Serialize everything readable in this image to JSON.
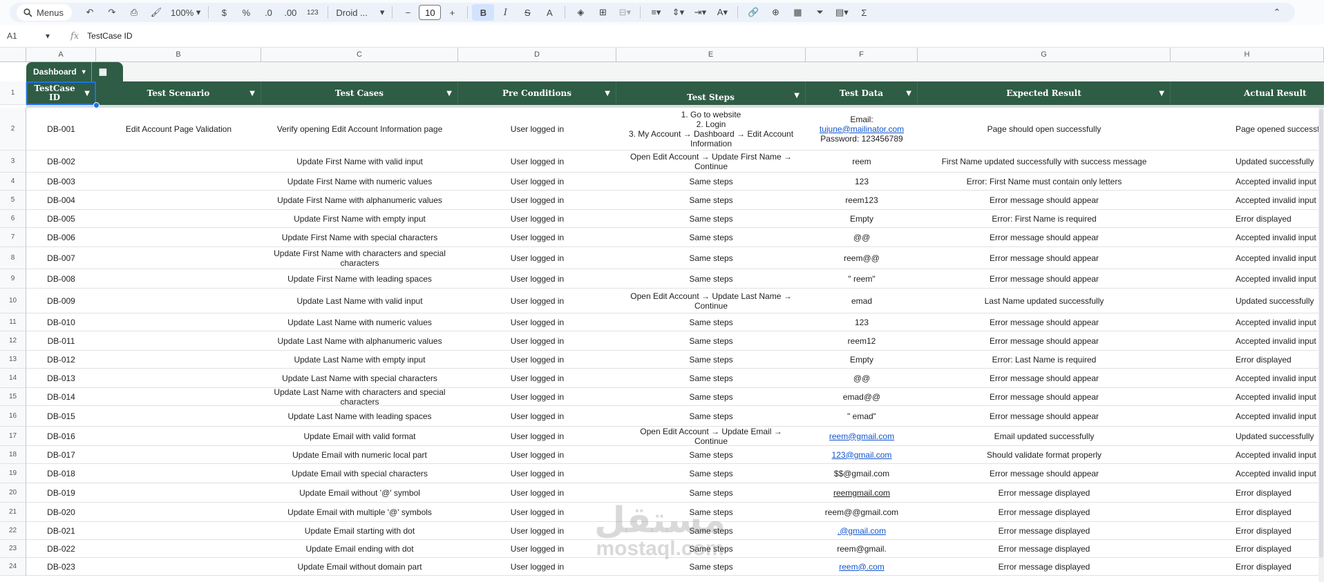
{
  "toolbar": {
    "search_label": "Menus",
    "zoom": "100%",
    "currency": "$",
    "percent": "%",
    "dec_decrease": ".0",
    "dec_increase": ".00",
    "number_format": "123",
    "font_name": "Droid ...",
    "font_size": "10",
    "bold": "B",
    "italic": "I",
    "strike": "S",
    "text_color": "A",
    "sum": "Σ"
  },
  "formula_bar": {
    "cell_ref": "A1",
    "fx": "fx",
    "content": "TestCase ID"
  },
  "columns": [
    "A",
    "B",
    "C",
    "D",
    "E",
    "F",
    "G",
    "H"
  ],
  "sheet_tab": {
    "name": "Dashboard"
  },
  "header": [
    "TestCase ID",
    "Test Scenario",
    "Test Cases",
    "Pre Conditions",
    "Test Steps",
    "Test Data",
    "Expected Result",
    "Actual Result"
  ],
  "row_numbers": [
    "1",
    "2",
    "3",
    "4",
    "5",
    "6",
    "7",
    "8",
    "9",
    "10",
    "11",
    "12",
    "13",
    "14",
    "15",
    "16",
    "17",
    "18",
    "19",
    "20",
    "21",
    "22",
    "23",
    "24"
  ],
  "rows": [
    {
      "id": "DB-001",
      "scenario": "Edit Account Page Validation",
      "case": "Verify opening Edit Account Information page",
      "pre": "User logged in",
      "steps": "1. Go to website\n2. Login\n3. My Account → Dashboard → Edit Account Information",
      "data_pre": "Email:",
      "data_link": "tujune@mailinator.com",
      "data_post": "Password: 123456789",
      "expected": "Page should open successfully",
      "actual": "Page opened successfully"
    },
    {
      "id": "DB-002",
      "scenario": "",
      "case": "Update First Name with valid input",
      "pre": "User logged in",
      "steps": "Open Edit Account → Update First Name → Continue",
      "data": "reem",
      "expected": "First Name updated successfully with success message",
      "actual": "Updated successfully"
    },
    {
      "id": "DB-003",
      "scenario": "",
      "case": "Update First Name with numeric values",
      "pre": "User logged in",
      "steps": "Same steps",
      "data": "123",
      "expected": "Error: First Name must contain only letters",
      "actual": "Accepted invalid input"
    },
    {
      "id": "DB-004",
      "scenario": "",
      "case": "Update First Name with alphanumeric values",
      "pre": "User logged in",
      "steps": "Same steps",
      "data": "reem123",
      "expected": "Error message should appear",
      "actual": "Accepted invalid input"
    },
    {
      "id": "DB-005",
      "scenario": "",
      "case": "Update First Name with empty input",
      "pre": "User logged in",
      "steps": "Same steps",
      "data": "Empty",
      "expected": "Error: First Name is required",
      "actual": "Error displayed"
    },
    {
      "id": "DB-006",
      "scenario": "",
      "case": "Update First Name with special characters",
      "pre": "User logged in",
      "steps": "Same steps",
      "data": "@@",
      "expected": "Error message should appear",
      "actual": "Accepted invalid input"
    },
    {
      "id": "DB-007",
      "scenario": "",
      "case": "Update First Name with characters and special characters",
      "pre": "User logged in",
      "steps": "Same steps",
      "data": "reem@@",
      "expected": "Error message should appear",
      "actual": "Accepted invalid input"
    },
    {
      "id": "DB-008",
      "scenario": "",
      "case": "Update First Name with leading spaces",
      "pre": "User logged in",
      "steps": "Same steps",
      "data": "\" reem\"",
      "expected": "Error message should appear",
      "actual": "Accepted invalid input"
    },
    {
      "id": "DB-009",
      "scenario": "",
      "case": "Update Last Name with valid input",
      "pre": "User logged in",
      "steps": "Open Edit Account → Update Last Name → Continue",
      "data": "emad",
      "expected": "Last Name updated successfully",
      "actual": "Updated successfully"
    },
    {
      "id": "DB-010",
      "scenario": "",
      "case": "Update Last Name with numeric values",
      "pre": "User logged in",
      "steps": "Same steps",
      "data": "123",
      "expected": "Error message should appear",
      "actual": "Accepted invalid input"
    },
    {
      "id": "DB-011",
      "scenario": "",
      "case": "Update Last Name with alphanumeric values",
      "pre": "User logged in",
      "steps": "Same steps",
      "data": "reem12",
      "expected": "Error message should appear",
      "actual": "Accepted invalid input"
    },
    {
      "id": "DB-012",
      "scenario": "",
      "case": "Update Last Name with empty input",
      "pre": "User logged in",
      "steps": "Same steps",
      "data": "Empty",
      "expected": "Error: Last Name is required",
      "actual": "Error displayed"
    },
    {
      "id": "DB-013",
      "scenario": "",
      "case": "Update Last Name with special characters",
      "pre": "User logged in",
      "steps": "Same steps",
      "data": "@@",
      "expected": "Error message should appear",
      "actual": "Accepted invalid input"
    },
    {
      "id": "DB-014",
      "scenario": "",
      "case": "Update Last Name with characters and special characters",
      "pre": "User logged in",
      "steps": "Same steps",
      "data": "emad@@",
      "expected": "Error message should appear",
      "actual": "Accepted invalid input"
    },
    {
      "id": "DB-015",
      "scenario": "",
      "case": "Update Last Name with leading spaces",
      "pre": "User logged in",
      "steps": "Same steps",
      "data": "\" emad\"",
      "expected": "Error message should appear",
      "actual": "Accepted invalid input"
    },
    {
      "id": "DB-016",
      "scenario": "",
      "case": "Update Email with valid format",
      "pre": "User logged in",
      "steps": "Open Edit Account → Update Email → Continue",
      "data": "reem@gmail.com",
      "data_is_link": true,
      "expected": "Email updated successfully",
      "actual": "Updated successfully"
    },
    {
      "id": "DB-017",
      "scenario": "",
      "case": "Update Email with numeric local part",
      "pre": "User logged in",
      "steps": "Same steps",
      "data": "123@gmail.com",
      "data_is_link": true,
      "expected": "Should validate format properly",
      "actual": "Accepted invalid input"
    },
    {
      "id": "DB-018",
      "scenario": "",
      "case": "Update Email with special characters",
      "pre": "User logged in",
      "steps": "Same steps",
      "data": "$$@gmail.com",
      "expected": "Error message should appear",
      "actual": "Accepted invalid input"
    },
    {
      "id": "DB-019",
      "scenario": "",
      "case": "Update Email without '@' symbol",
      "pre": "User logged in",
      "steps": "Same steps",
      "data": "reemgmail.com",
      "data_underline": true,
      "expected": "Error message displayed",
      "actual": "Error displayed"
    },
    {
      "id": "DB-020",
      "scenario": "",
      "case": "Update Email with multiple '@' symbols",
      "pre": "User logged in",
      "steps": "Same steps",
      "data": "reem@@gmail.com",
      "expected": "Error message displayed",
      "actual": "Error displayed"
    },
    {
      "id": "DB-021",
      "scenario": "",
      "case": "Update Email starting with dot",
      "pre": "User logged in",
      "steps": "Same steps",
      "data": ".@gmail.com",
      "data_is_link": true,
      "expected": "Error message displayed",
      "actual": "Error displayed"
    },
    {
      "id": "DB-022",
      "scenario": "",
      "case": "Update Email ending with dot",
      "pre": "User logged in",
      "steps": "Same steps",
      "data": "reem@gmail.",
      "expected": "Error message displayed",
      "actual": "Error displayed"
    },
    {
      "id": "DB-023",
      "scenario": "",
      "case": "Update Email without domain part",
      "pre": "User logged in",
      "steps": "Same steps",
      "data": "reem@.com",
      "data_is_link": true,
      "expected": "Error message displayed",
      "actual": "Error displayed"
    }
  ],
  "watermark": {
    "arabic": "مستقل",
    "latin": "mostaql.com"
  },
  "colors": {
    "header_green": "#2f5c45",
    "selection": "#1a73e8",
    "link": "#1155cc"
  }
}
